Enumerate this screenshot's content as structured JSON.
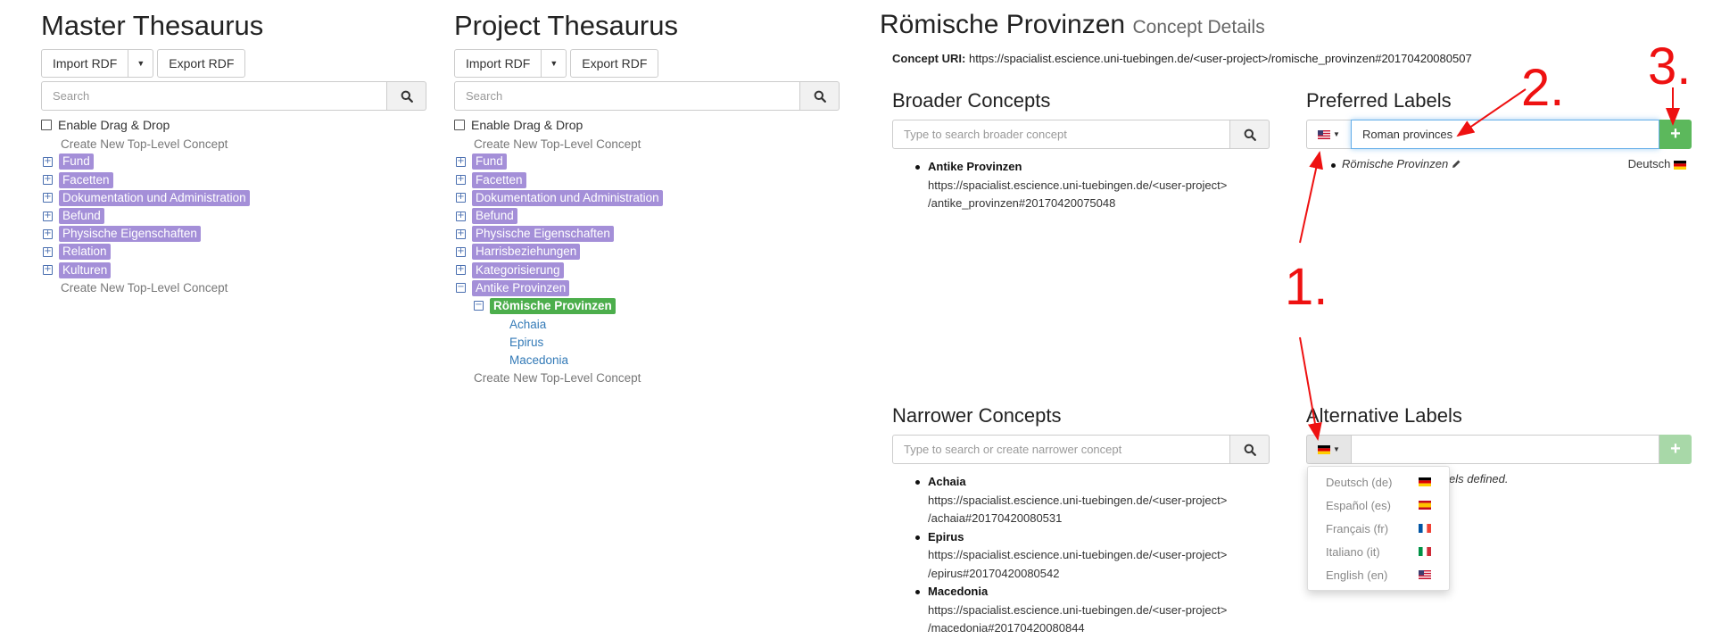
{
  "master": {
    "title": "Master Thesaurus",
    "import_label": "Import RDF",
    "export_label": "Export RDF",
    "search_placeholder": "Search",
    "drag_drop_label": "Enable Drag & Drop",
    "create_top_label": "Create New Top-Level Concept",
    "nodes": [
      "Fund",
      "Facetten",
      "Dokumentation und Administration",
      "Befund",
      "Physische Eigenschaften",
      "Relation",
      "Kulturen"
    ],
    "create_bottom_label": "Create New Top-Level Concept"
  },
  "project": {
    "title": "Project Thesaurus",
    "import_label": "Import RDF",
    "export_label": "Export RDF",
    "search_placeholder": "Search",
    "drag_drop_label": "Enable Drag & Drop",
    "create_top_label": "Create New Top-Level Concept",
    "nodes": [
      "Fund",
      "Facetten",
      "Dokumentation und Administration",
      "Befund",
      "Physische Eigenschaften",
      "Harrisbeziehungen",
      "Kategorisierung",
      "Antike Provinzen"
    ],
    "selected_node": "Römische Provinzen",
    "children": [
      "Achaia",
      "Epirus",
      "Macedonia"
    ],
    "create_bottom_label": "Create New Top-Level Concept"
  },
  "detail": {
    "title": "Römische Provinzen",
    "subtitle": "Concept Details",
    "uri_label": "Concept URI:",
    "uri_value": "https://spacialist.escience.uni-tuebingen.de/<user-project>/romische_provinzen#20170420080507",
    "broader": {
      "title": "Broader Concepts",
      "placeholder": "Type to search broader concept",
      "items": [
        {
          "name": "Antike Provinzen",
          "line1": "https://spacialist.escience.uni-tuebingen.de/<user-project>",
          "line2": "/antike_provinzen#20170420075048"
        }
      ]
    },
    "preferred": {
      "title": "Preferred Labels",
      "input_value": "Roman provinces",
      "label": "Römische Provinzen",
      "language": "Deutsch"
    },
    "narrower": {
      "title": "Narrower Concepts",
      "placeholder": "Type to search or create narrower concept",
      "items": [
        {
          "name": "Achaia",
          "line1": "https://spacialist.escience.uni-tuebingen.de/<user-project>",
          "line2": "/achaia#20170420080531"
        },
        {
          "name": "Epirus",
          "line1": "https://spacialist.escience.uni-tuebingen.de/<user-project>",
          "line2": "/epirus#20170420080542"
        },
        {
          "name": "Macedonia",
          "line1": "https://spacialist.escience.uni-tuebingen.de/<user-project>",
          "line2": "/macedonia#20170420080844"
        }
      ]
    },
    "alternative": {
      "title": "Alternative Labels",
      "empty_fragment": "els defined.",
      "languages": [
        "Deutsch (de)",
        "Español (es)",
        "Français (fr)",
        "Italiano (it)",
        "English (en)"
      ]
    }
  },
  "annotations": {
    "one": "1.",
    "two": "2.",
    "three": "3.",
    "color": "#ee1111"
  }
}
